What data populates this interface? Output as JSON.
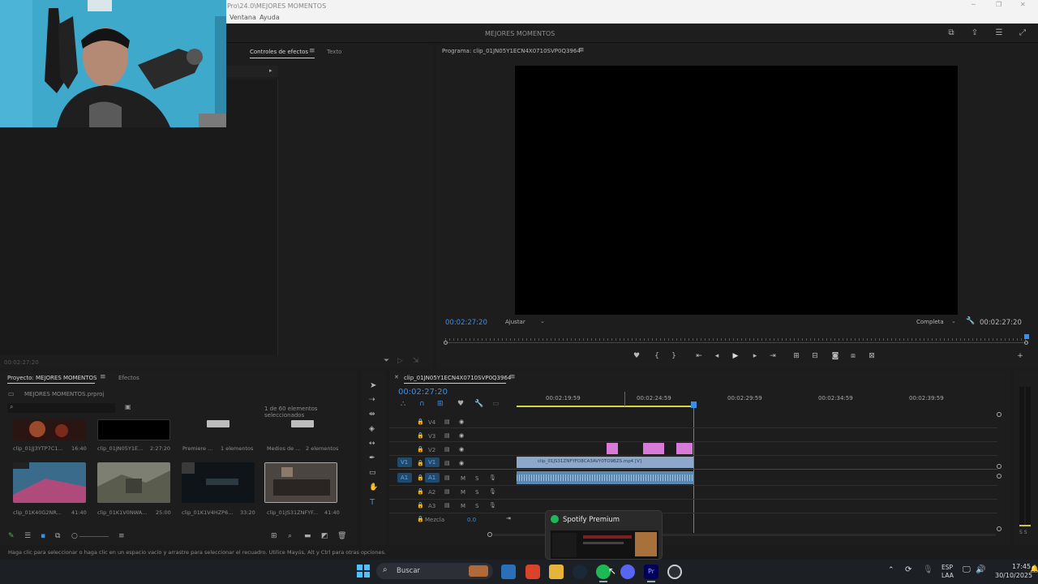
{
  "window": {
    "title": "Pro\\24.0\\MEJORES MOMENTOS",
    "menu": [
      "Ventana",
      "Ayuda"
    ],
    "workspace_title": "MEJORES MOMENTOS"
  },
  "effect_controls": {
    "tabs": [
      "Controles de efectos",
      "Texto"
    ],
    "timecode": "00:02:27:20"
  },
  "program": {
    "title": "Programa: clip_01JN05Y1ECN4X0710SVP0Q3964",
    "timecode": "00:02:27:20",
    "fit": "Ajustar",
    "quality": "Completa",
    "duration": "00:02:27:20"
  },
  "project": {
    "tabs": [
      "Proyecto: MEJORES MOMENTOS",
      "Efectos"
    ],
    "file": "MEJORES MOMENTOS.prproj",
    "selection": "1 de 60 elementos seleccionados",
    "items": [
      {
        "name": "clip_01JJ3YTP7C1...",
        "meta": "16:40"
      },
      {
        "name": "clip_01JN05Y1E...",
        "meta": "2:27:20"
      },
      {
        "name": "Premiere ...",
        "meta": "1 elementos"
      },
      {
        "name": "Medios de ...",
        "meta": "2 elementos"
      },
      {
        "name": "clip_01K40G2NR...",
        "meta": "41:40"
      },
      {
        "name": "clip_01K1V0NWA...",
        "meta": "25:00"
      },
      {
        "name": "clip_01K1V4HZP6...",
        "meta": "33:20"
      },
      {
        "name": "clip_01JS31ZNFYF...",
        "meta": "41:40"
      }
    ]
  },
  "timeline": {
    "title": "clip_01JN05Y1ECN4X0710SVP0Q3964",
    "timecode": "00:02:27:20",
    "ruler": [
      "00:02:19:59",
      "00:02:24:59",
      "00:02:29:59",
      "00:02:34:59",
      "00:02:39:59"
    ],
    "video_tracks": [
      "V4",
      "V3",
      "V2",
      "V1"
    ],
    "audio_tracks": [
      "A1",
      "A2",
      "A3"
    ],
    "mix_label": "Mezcla",
    "mix_value": "0.0",
    "clip_label": "clip_01JS31ZNFYFD8CA3AVY0TO9BZS.mp4 [V]",
    "source_v": "V1",
    "source_a": "A1"
  },
  "status": "Haga clic para seleccionar o haga clic en un espacio vacío y arrastre para seleccionar el recuadro. Utilice Mayús, Alt y Ctrl para otras opciones.",
  "taskbar": {
    "search": "Buscar",
    "lang": "ESP",
    "lang2": "LAA",
    "time": "17:45",
    "date": "30/10/2025",
    "popup": "Spotify Premium"
  },
  "colors": {
    "accent": "#2d8ceb",
    "clip_video": "#8ea8cc",
    "clip_pink": "#d77ad8",
    "playhead": "#3b8ee8"
  }
}
